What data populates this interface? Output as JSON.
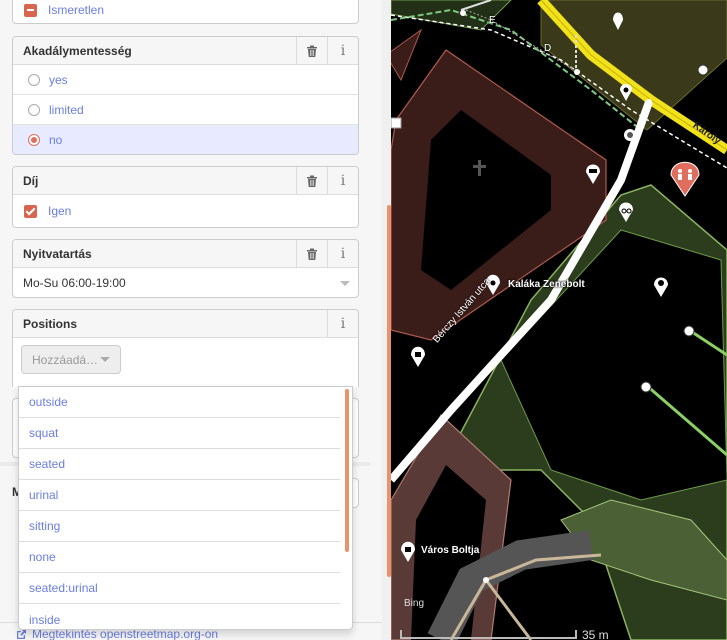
{
  "sidebar": {
    "fields": {
      "unknown_row": {
        "label": "Ismeretlen"
      },
      "accessibility": {
        "title": "Akadálymentesség",
        "options": [
          {
            "label": "yes",
            "selected": false
          },
          {
            "label": "limited",
            "selected": false
          },
          {
            "label": "no",
            "selected": true
          }
        ]
      },
      "fee": {
        "title": "Díj",
        "value_label": "Igen",
        "checked": true
      },
      "opening_hours": {
        "title": "Nyitvatartás",
        "value": "Mo-Su 06:00-19:00"
      },
      "positions": {
        "title": "Positions",
        "placeholder": "Hozzáadá…"
      }
    },
    "partial_letter": "M",
    "dropdown_options": [
      "outside",
      "squat",
      "seated",
      "urinal",
      "sitting",
      "none",
      "seated:urinal",
      "inside"
    ],
    "footer_link": "Megtekintés openstreetmap.org-on"
  },
  "map": {
    "labels": {
      "music_shop": "Kaláka Zenebolt",
      "shop": "Város Boltja",
      "street": "Bérczy István utca",
      "road": "Károly",
      "road_letter_e": "E",
      "road_letter_d": "D"
    },
    "attribution": "Bing",
    "scale": "35 m",
    "colors": {
      "background": "#000000",
      "building_fill": "#3a1c18",
      "building_stroke": "#b05a4c",
      "park_fill": "#2c3d1d",
      "park_stroke": "#8ab35f",
      "main_road": "#f3e21a",
      "selected_pin": "#e06e5f"
    }
  },
  "colors": {
    "accent": "#e06e5f",
    "link": "#6a7ee0",
    "scroll": "#e8936e"
  }
}
